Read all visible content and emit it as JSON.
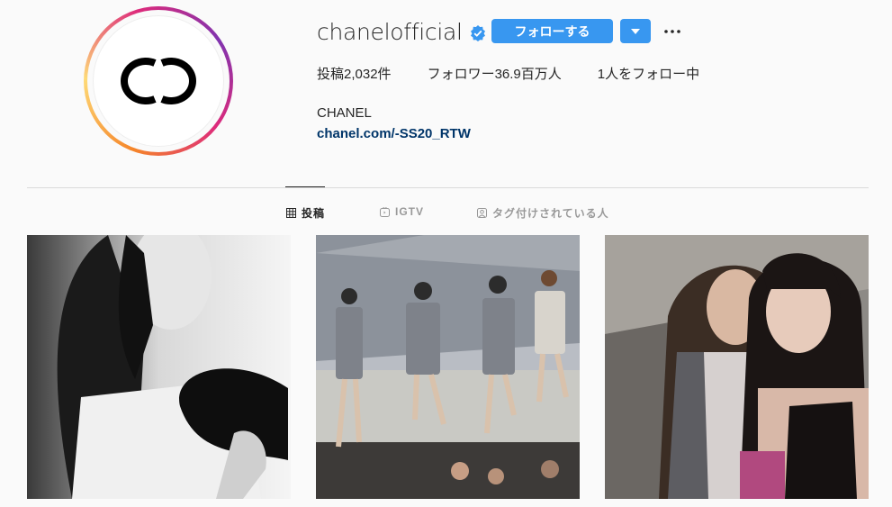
{
  "profile": {
    "username": "chanelofficial",
    "verified_icon": "verified-badge-icon",
    "follow_label": "フォローする",
    "dropdown_icon": "caret-down-icon",
    "more_icon": "more-horizontal-icon",
    "stats": {
      "posts_label": "投稿",
      "posts_value": "2,032件",
      "followers_label": "フォロワー",
      "followers_value": "36.9百万人",
      "following_value": "1人をフォロー中"
    },
    "full_name": "CHANEL",
    "website": "chanel.com/-SS20_RTW"
  },
  "tabs": [
    {
      "label": "投稿",
      "icon": "grid-icon",
      "active": true
    },
    {
      "label": "IGTV",
      "icon": "igtv-icon",
      "active": false
    },
    {
      "label": "タグ付けされている人",
      "icon": "tagged-icon",
      "active": false
    }
  ],
  "posts": [
    {
      "description_icon": "photo-bw-portrait"
    },
    {
      "description_icon": "photo-runway"
    },
    {
      "description_icon": "photo-two-women"
    }
  ],
  "colors": {
    "accent": "#3897f0",
    "link": "#003569",
    "text": "#262626",
    "muted": "#999999",
    "background": "#fafafa"
  }
}
